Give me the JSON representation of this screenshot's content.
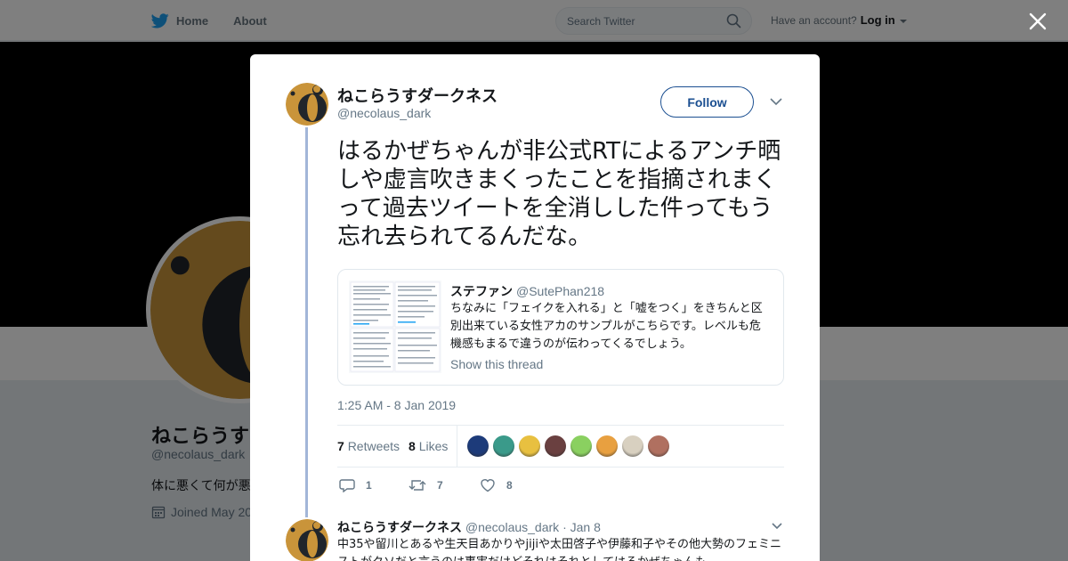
{
  "nav": {
    "home_label": "Home",
    "about_label": "About",
    "search_placeholder": "Search Twitter",
    "have_account": "Have an account?",
    "login_label": "Log in"
  },
  "background_profile": {
    "name": "ねこらうす",
    "handle": "@necolaus_dark",
    "bio": "体に悪くて何が悪",
    "joined": "Joined May 20"
  },
  "tweet": {
    "author_name": "ねこらうすダークネス",
    "author_handle": "@necolaus_dark",
    "follow_label": "Follow",
    "text": "はるかぜちゃんが非公式RTによるアンチ晒しや虚言吹きまくったことを指摘されまくって過去ツイートを全消しした件ってもう忘れ去られてるんだな。",
    "quote": {
      "name": "ステファン",
      "handle": "@SutePhan218",
      "text": "ちなみに「フェイクを入れる」と「嘘をつく」をきちんと区別出来ている女性アカのサンプルがこちらです。レベルも危機感もまるで違うのが伝わってくるでしょう。",
      "link": "Show this thread"
    },
    "timestamp": "1:25 AM - 8 Jan 2019",
    "retweets_count": "7",
    "retweets_label": "Retweets",
    "likes_count": "8",
    "likes_label": "Likes",
    "likers": [
      "#1d3b7a",
      "#3a9a8a",
      "#e8c040",
      "#6a4040",
      "#8ad060",
      "#e8a040",
      "#d8d0c0",
      "#b07060"
    ],
    "reply_count": "1",
    "retweet_action_count": "7",
    "like_action_count": "8"
  },
  "reply": {
    "name": "ねこらうすダークネス",
    "handle": "@necolaus_dark",
    "date": "· Jan 8",
    "text": "中35や留川とあるや生天目あかりやjijiや太田啓子や伊藤和子やその他大勢のフェミニストがクソだと言うのは事実だけどそれはそれとしてはるかぜちゃんも"
  },
  "colors": {
    "twitter_blue": "#1da1f2",
    "follow_blue": "#1b4f91",
    "thread_line": "#a2b6d8",
    "avatar_gold": "#c9943a"
  }
}
